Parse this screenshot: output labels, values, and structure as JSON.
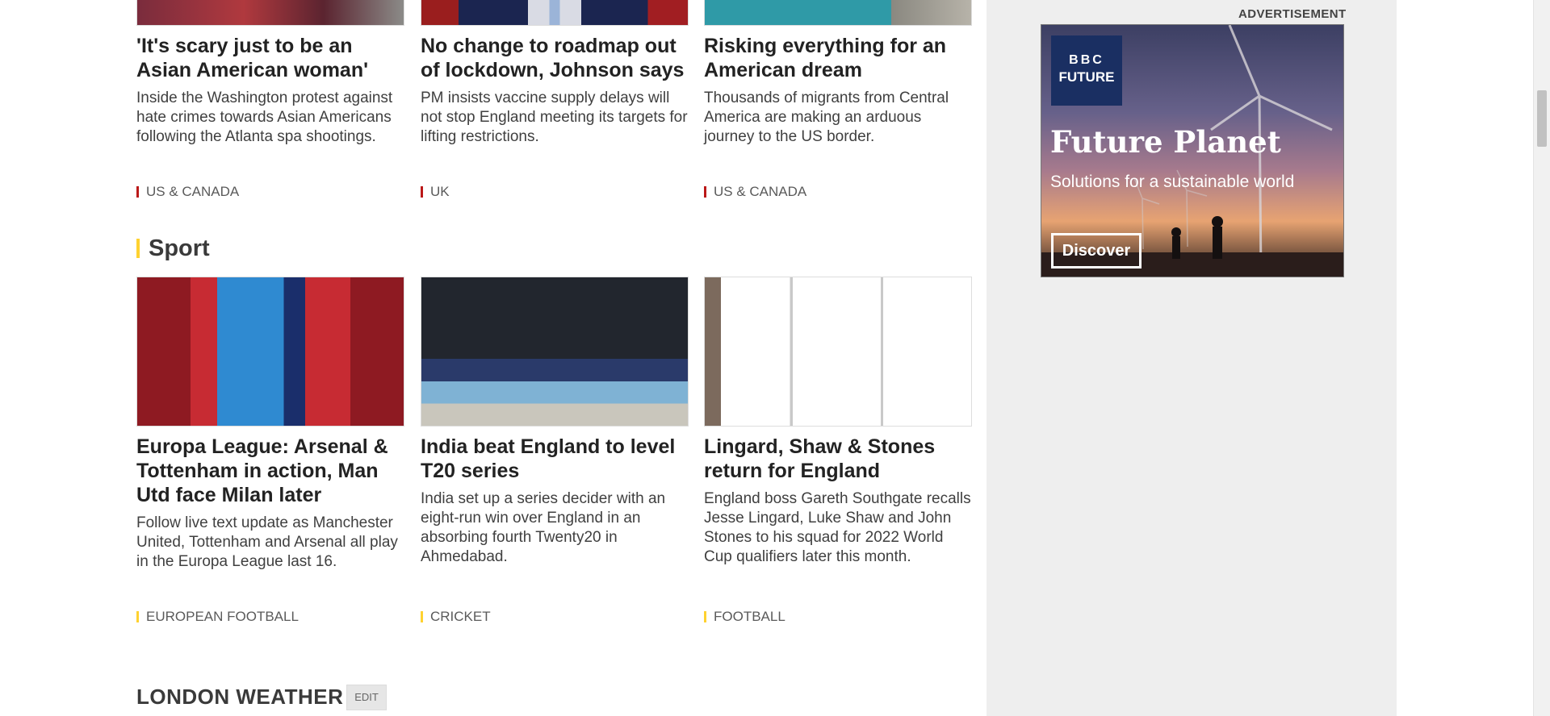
{
  "top_row": [
    {
      "headline": "'It's scary just to be an Asian American woman'",
      "summary": "Inside the Washington protest against hate crimes towards Asian Americans following the Atlanta spa shootings.",
      "tag": "US & CANADA",
      "tag_color": "#bb1919"
    },
    {
      "headline": "No change to roadmap out of lockdown, Johnson says",
      "summary": "PM insists vaccine supply delays will not stop England meeting its targets for lifting restrictions.",
      "tag": "UK",
      "tag_color": "#bb1919"
    },
    {
      "headline": "Risking everything for an American dream",
      "summary": "Thousands of migrants from Central America are making an arduous journey to the US border.",
      "tag": "US & CANADA",
      "tag_color": "#bb1919"
    }
  ],
  "sport": {
    "title": "Sport",
    "accent": "#ffd230",
    "stories": [
      {
        "headline": "Europa League: Arsenal & Tottenham in action, Man Utd face Milan later",
        "summary": "Follow live text update as Manchester United, Tottenham and Arsenal all play in the Europa League last 16.",
        "tag": "EUROPEAN FOOTBALL",
        "tag_color": "#ffd230"
      },
      {
        "headline": "India beat England to level T20 series",
        "summary": "India set up a series decider with an eight-run win over England in an absorbing fourth Twenty20 in Ahmedabad.",
        "tag": "CRICKET",
        "tag_color": "#ffd230"
      },
      {
        "headline": "Lingard, Shaw & Stones return for England",
        "summary": "England boss Gareth Southgate recalls Jesse Lingard, Luke Shaw and John Stones to his squad for 2022 World Cup qualifiers later this month.",
        "tag": "FOOTBALL",
        "tag_color": "#ffd230"
      }
    ]
  },
  "weather": {
    "title": "LONDON WEATHER",
    "edit_label": "EDIT"
  },
  "advert": {
    "label": "ADVERTISEMENT",
    "logo_line1": "BBC",
    "logo_line2": "FUTURE",
    "title": "Future Planet",
    "subtitle": "Solutions for a sustainable world",
    "button": "Discover"
  }
}
